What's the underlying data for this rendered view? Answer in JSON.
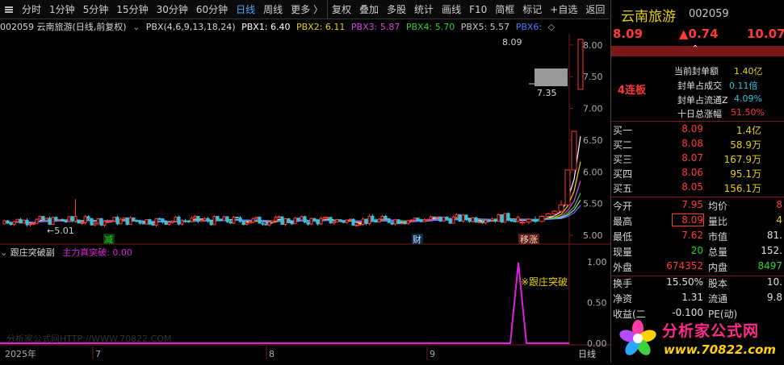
{
  "toolbar": {
    "items": [
      "分时",
      "1分钟",
      "5分钟",
      "15分钟",
      "30分钟",
      "60分钟",
      "日线",
      "周线",
      "更多 〉",
      "复权",
      "叠加",
      "多股",
      "统计",
      "画线",
      "F10",
      "简框",
      "标记",
      "+自选",
      "返回"
    ],
    "active": "日线"
  },
  "legend": {
    "title": "002059 云南旅游(日线,前复权)",
    "indicator": "PBX(4,6,9,13,18,24)",
    "pbx1": "PBX1: 6.40",
    "pbx2": "PBX2: 6.11",
    "pbx3": "PBX3: 5.87",
    "pbx4": "PBX4: 5.70",
    "pbx5": "PBX5: 5.57",
    "pbx6": "PBX6:"
  },
  "colors": {
    "pbx1": "#ffffff",
    "pbx2": "#e8d100",
    "pbx3": "#e040e0",
    "pbx4": "#2fd12f",
    "pbx5": "#c8c8c8",
    "pbx6": "#4a7cff",
    "up": "#ff3838",
    "down": "#2fc4e0",
    "signal": "#e020e0"
  },
  "chart_data": {
    "type": "candlestick",
    "price_ticks": [
      "8.00",
      "7.50",
      "7.00",
      "6.50",
      "6.00",
      "5.50",
      "5.00"
    ],
    "ylim": [
      4.95,
      8.15
    ],
    "high_label": "8.09",
    "low_label": "←5.01",
    "price_tag": "7.35",
    "last_price": 7.35,
    "markers": [
      "减",
      "财",
      "移涨"
    ],
    "x_labels": [
      "2025年",
      "7",
      "8",
      "9"
    ],
    "period_label": "日线",
    "sub_ticks": [
      "1.00",
      "0.50",
      "0.00"
    ],
    "sub_signal_label": "※跟庄突破",
    "recent_bars": [
      {
        "o": 5.2,
        "h": 5.24,
        "l": 5.16,
        "c": 5.21
      },
      {
        "o": 5.21,
        "h": 5.27,
        "l": 5.18,
        "c": 5.25
      },
      {
        "o": 5.25,
        "h": 5.3,
        "l": 5.2,
        "c": 5.22
      },
      {
        "o": 5.22,
        "h": 5.32,
        "l": 5.2,
        "c": 5.3
      },
      {
        "o": 5.3,
        "h": 5.36,
        "l": 5.26,
        "c": 5.34
      },
      {
        "o": 5.34,
        "h": 5.4,
        "l": 5.3,
        "c": 5.38
      },
      {
        "o": 5.38,
        "h": 5.55,
        "l": 5.36,
        "c": 5.48
      },
      {
        "o": 5.48,
        "h": 6.03,
        "l": 5.48,
        "c": 6.03
      },
      {
        "o": 6.03,
        "h": 6.64,
        "l": 6.03,
        "c": 6.64
      },
      {
        "o": 7.3,
        "h": 8.09,
        "l": 7.3,
        "c": 8.09
      }
    ]
  },
  "sub_legend": {
    "title": "跟庄突破副",
    "field": "主力真突破: 0.00"
  },
  "quote": {
    "name": "云南旅游",
    "code": "002059",
    "price": "8.09",
    "change": "▲0.74",
    "pct": "10.07",
    "seal_amount_label": "当前封单额",
    "seal_amount": "1.40亿",
    "board": "4连板",
    "seal_vs_vol_label": "封单占成交",
    "seal_vs_vol": "0.11倍",
    "seal_vs_float_label": "封单占流通Z",
    "seal_vs_float": "4.09%",
    "ten_day_label": "十日总涨幅",
    "ten_day": "51.50%",
    "bids": [
      {
        "label": "买一",
        "price": "8.09",
        "vol": "1.4亿"
      },
      {
        "label": "买二",
        "price": "8.08",
        "vol": "58.9万"
      },
      {
        "label": "买三",
        "price": "8.07",
        "vol": "167.9万"
      },
      {
        "label": "买四",
        "price": "8.06",
        "vol": "95.1万"
      },
      {
        "label": "买五",
        "price": "8.05",
        "vol": "156.1万"
      }
    ],
    "stats": [
      {
        "l1": "今开",
        "v1": "7.95",
        "l2": "均价",
        "v2": "8"
      },
      {
        "l1": "最高",
        "v1": "8.09",
        "l2": "量比",
        "v2": "4"
      },
      {
        "l1": "最低",
        "v1": "7.62",
        "l2": "市值",
        "v2": "81."
      },
      {
        "l1": "现量",
        "v1": "20",
        "l2": "总量",
        "v2": "152."
      },
      {
        "l1": "外盘",
        "v1": "674352",
        "l2": "内盘",
        "v2": "8497"
      }
    ],
    "stats2": [
      {
        "l1": "换手",
        "v1": "15.50%",
        "l2": "股本",
        "v2": "10."
      },
      {
        "l1": "净资",
        "v1": "1.31",
        "l2": "流通",
        "v2": "9.8"
      },
      {
        "l1": "收益(二",
        "v1": "-0.100",
        "l2": "PE(动)",
        "v2": ""
      }
    ]
  },
  "logo": {
    "name": "分析家公式网",
    "url": "www.70822.com"
  },
  "watermark": "分析家公式网HTTP://WWW.70822.COM"
}
